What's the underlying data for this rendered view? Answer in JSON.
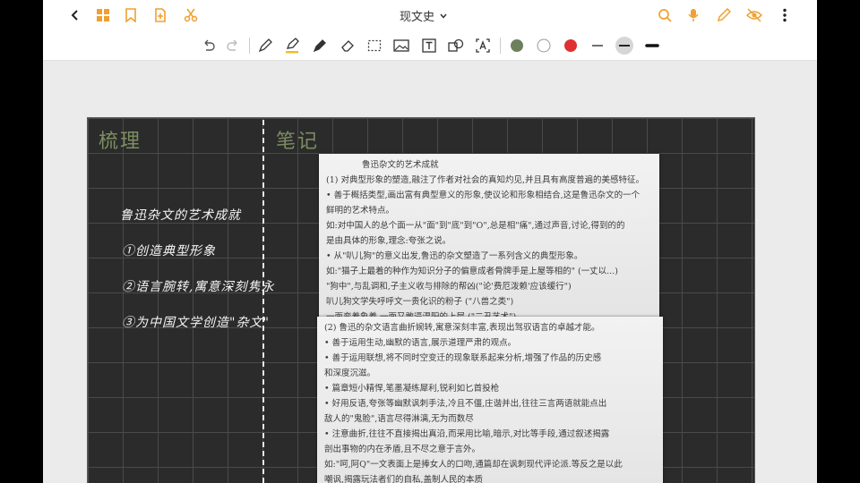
{
  "document": {
    "title": "现文史"
  },
  "colors": {
    "accent": "#f0a030",
    "board": "#2b2b2b",
    "heading": "#7d8d62",
    "swatch_green": "#6e7f5e",
    "swatch_red": "#e03030"
  },
  "board": {
    "left_heading": "梳理",
    "right_heading": "笔记",
    "outline": [
      "鲁迅杂文的艺术成就",
      "①创造典型形象",
      "②语言腕转,寓意深刻隽永",
      "③为中国文学创造\"杂文\""
    ]
  },
  "photo_top": {
    "lines": [
      "鲁迅杂文的艺术成就",
      "(1) 对典型形象的塑造,融注了作者对社会的真知灼见,并且具有高度普遍的美感特征。",
      "• 善于概括类型,画出富有典型意义的形象,使议论和形象相结合,这是鲁迅杂文的一个",
      "鲜明的艺术特点。",
      "如:对中国人的总个面一从\"面\"到\"底\"到\"O\",总是相\"痛\",通过声音,讨论,得到的的",
      "是由具体的形象,理念:夸张之说。",
      "• 从\"叭儿狗\"的意义出发,鲁迅的杂文塑造了一系列含义的典型形象。",
      "如:\"猫子上最着的种作为知识分子的偏意成者骨牌手是上屋等相的\" (一丈以...)",
      "\"狗中\",与乱调和,子主义收与排除的帮凶(\"论'费厄泼赖'应该缓行\")",
      "叭儿狗文学失呼呼文一贵化识的粉子 (\"八兽之类\")",
      "一面变着象养,一面又敢逼温阳的上层 (\"二丑艺术\")"
    ]
  },
  "photo_bottom": {
    "lines": [
      "(2) 鲁迅的杂文语言曲折婉转,寓意深刻丰富,表现出驾驭语言的卓越才能。",
      "• 善于运用生动,幽默的语言,展示道理严肃的观点。",
      "• 善于运用联想,将不同时空变迁的现象联系起来分析,增强了作品的历史感",
      "和深度沉滋。",
      "• 篇章短小精悍,笔墨凝练犀利,锐利如匕首投枪",
      "• 好用反语,夸张等幽默讽刺手法,冷且不僵,庄谐并出,往往三言两语就能点出",
      "敌人的\"鬼脸\",语言尽得淋漓,无为而数尽",
      "• 注意曲折,往往不直接揭出真沿,而采用比喻,暗示,对比等手段,通过叙述揭露",
      "剖出事物的内在矛盾,且不尽之意于言外。",
      "如:\"呵,阿Q\"一文表面上是捧女人的口吻,通篇却在讽刺现代评论派.等反之是以此",
      "嘲讽,揭露玩法者们的自私,盖制人民的本质"
    ]
  },
  "toolbar": {
    "icons_left": [
      "back-icon",
      "grid-icon",
      "bookmark-icon",
      "add-page-icon",
      "scissors-icon"
    ],
    "icons_right": [
      "search-icon",
      "microphone-icon",
      "pen-edit-icon",
      "eye-off-icon",
      "more-icon"
    ],
    "tools": [
      "undo-icon",
      "redo-icon",
      "pen-icon",
      "highlighter-icon",
      "marker-icon",
      "eraser-icon",
      "lasso-select-icon",
      "image-icon",
      "text-icon",
      "shape-icon",
      "ocr-text-icon"
    ]
  }
}
